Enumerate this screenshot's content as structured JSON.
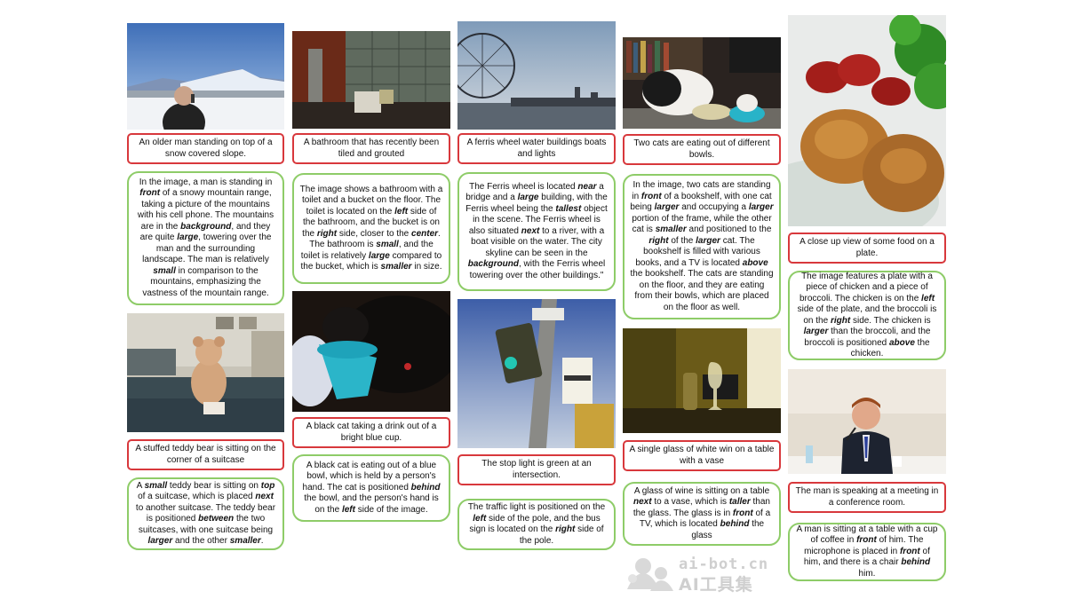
{
  "col1": {
    "cap1": "An older man standing on top of a snow covered slope.",
    "desc1": "In the image, a man is standing in <b>front</b> of a snowy mountain range, taking a picture of the mountains with his cell phone. The mountains are in the <b>background</b>, and they are quite <b>large</b>, towering over the man and the surrounding landscape. The man is relatively <b>small</b> in comparison to the mountains, emphasizing the vastness of the mountain range.",
    "cap2": "A stuffed teddy bear is sitting on the corner of a suitcase",
    "desc2": "A <b>small</b> teddy bear is sitting on <b>top</b> of a suitcase, which is placed <b>next</b> to another suitcase. The teddy bear is positioned <b>between</b> the two suitcases, with one suitcase being <b>larger</b> and the other <b>smaller</b>."
  },
  "col2": {
    "cap1": "A bathroom that has recently been tiled and grouted",
    "desc1": "The image shows a bathroom with a toilet and a bucket on the floor. The toilet is located on the <b>left</b> side of the bathroom, and the bucket is on the <b>right</b> side, closer to the <b>center</b>. The bathroom is <b>small</b>, and the toilet is relatively <b>large</b> compared to the bucket, which is <b>smaller</b> in size.",
    "cap2": "A black cat taking a drink out of a bright blue cup.",
    "desc2": "A black cat is eating out of a blue bowl, which is held by a person's hand. The cat is positioned <b>behind</b> the bowl, and the person's hand is on the <b>left</b> side of the image."
  },
  "col3": {
    "cap1": "A ferris wheel water buildings boats and lights",
    "desc1": "The Ferris wheel is located <b>near</b> a bridge and a <b>large</b> building, with the Ferris wheel being the <b>tallest</b> object in the scene. The Ferris wheel is also situated <b>next</b> to a river, with a boat visible on the water. The city skyline can be seen in the <b>background</b>, with the Ferris wheel towering over the other buildings.\"",
    "cap2": "The stop light is green at an intersection.",
    "desc2": "The traffic light is positioned on the <b>left</b> side of the pole, and the bus sign is located on the <b>right</b> side of the pole."
  },
  "col4": {
    "cap1": "Two cats are eating out of different bowls.",
    "desc1": "In the image, two cats are standing in <b>front</b> of a bookshelf, with one cat being <b>larger</b> and occupying a <b>larger</b> portion of the frame, while the other cat is <b>smaller</b> and positioned to the <b>right</b> of the <b>larger</b> cat. The bookshelf is filled with various books, and a TV is located <b>above</b> the bookshelf. The cats are standing on the floor, and they are eating from their bowls, which are placed on the floor as well.",
    "cap2": "A single glass of white win on a table with a vase",
    "desc2": "A glass of wine is sitting on a table <b>next</b> to a vase, which is <b>taller</b> than the glass. The glass is in <b>front</b> of a TV, which is located <b>behind</b> the glass"
  },
  "col5": {
    "cap1": "A close up view of some food on a plate.",
    "desc1": "The image features a plate with a piece of chicken and a piece of broccoli. The chicken is on the <b>left</b> side of the plate, and the broccoli is on the <b>right</b> side. The chicken is <b>larger</b> than the broccoli, and the broccoli is positioned <b>above</b> the chicken.",
    "cap2": "The man is speaking at a meeting in a conference room.",
    "desc2": "A man is sitting at a table with a cup of coffee in <b>front</b> of him. The microphone is placed in <b>front</b> of him, and there is a chair <b>behind</b> him."
  },
  "watermark": {
    "line1": "ai-bot.cn",
    "line2": "AI工具集"
  }
}
